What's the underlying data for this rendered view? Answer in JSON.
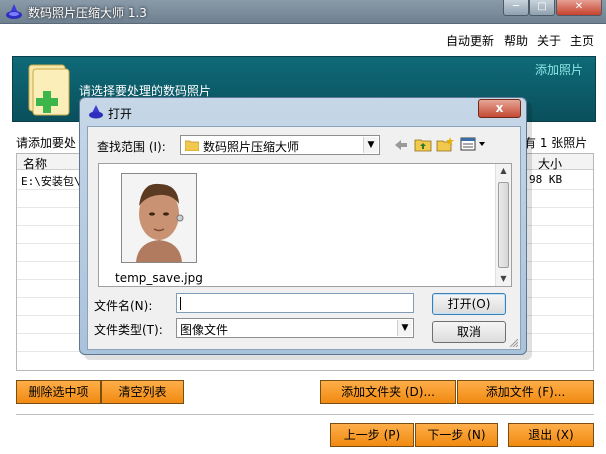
{
  "window": {
    "title": "数码照片压缩大师 1.3",
    "controls": {
      "min": "─",
      "max": "□",
      "close": "✕"
    }
  },
  "menu": {
    "items": [
      "自动更新",
      "帮助",
      "关于",
      "主页"
    ]
  },
  "banner": {
    "text": "请选择要处理的数码照片",
    "link": "添加照片"
  },
  "list": {
    "label_left": "请添加要处",
    "label_right": "有 1 张照片",
    "columns": {
      "name": "名称",
      "size": "大小"
    },
    "rows": [
      {
        "path": "E:\\安装包\\",
        "size": "98 KB"
      }
    ]
  },
  "buttons": {
    "delete_selected": "删除选中项",
    "clear_list": "清空列表",
    "add_folder": "添加文件夹 (D)...",
    "add_file": "添加文件 (F)...",
    "prev": "上一步 (P)",
    "next": "下一步 (N)",
    "exit": "退出 (X)"
  },
  "dialog": {
    "title": "打开",
    "close": "x",
    "lookin_label": "查找范围 (I):",
    "lookin_value": "数码照片压缩大师",
    "file": {
      "name": "temp_save.jpg"
    },
    "filename_label": "文件名(N):",
    "filename_value": "",
    "filetype_label": "文件类型(T):",
    "filetype_value": "图像文件",
    "open_button": "打开(O)",
    "cancel_button": "取消"
  },
  "colors": {
    "banner": "#0f6a78",
    "orange_button": "#f59a24",
    "dialog_frame": "#b9cde2"
  }
}
